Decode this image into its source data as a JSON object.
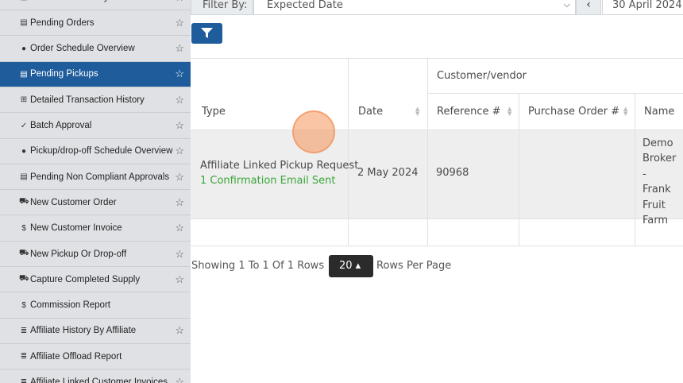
{
  "sidebar": {
    "items": [
      {
        "label": "Transaction History",
        "icon": "clipboard-icon",
        "glyph": "▤",
        "star": true,
        "active": false
      },
      {
        "label": "Pending Orders",
        "icon": "clipboard-icon",
        "glyph": "▤",
        "star": true,
        "active": false
      },
      {
        "label": "Order Schedule Overview",
        "icon": "clock-icon",
        "glyph": "●",
        "star": true,
        "active": false
      },
      {
        "label": "Pending Pickups",
        "icon": "clipboard-icon",
        "glyph": "▤",
        "star": true,
        "active": true
      },
      {
        "label": "Detailed Transaction History",
        "icon": "table-icon",
        "glyph": "⊞",
        "star": true,
        "active": false
      },
      {
        "label": "Batch Approval",
        "icon": "check-icon",
        "glyph": "✓",
        "star": true,
        "active": false
      },
      {
        "label": "Pickup/drop-off Schedule Overview",
        "icon": "clock-icon",
        "glyph": "●",
        "star": true,
        "active": false
      },
      {
        "label": "Pending Non Compliant Approvals",
        "icon": "clipboard-icon",
        "glyph": "▤",
        "star": true,
        "active": false
      },
      {
        "label": "New Customer Order",
        "icon": "truck-icon",
        "glyph": "⛟",
        "star": true,
        "active": false
      },
      {
        "label": "New Customer Invoice",
        "icon": "dollar-icon",
        "glyph": "$",
        "star": true,
        "active": false
      },
      {
        "label": "New Pickup Or Drop-off",
        "icon": "truck-icon",
        "glyph": "⛟",
        "star": true,
        "active": false
      },
      {
        "label": "Capture Completed Supply",
        "icon": "cart-icon",
        "glyph": "⛟",
        "star": true,
        "active": false
      },
      {
        "label": "Commission Report",
        "icon": "dollar-icon",
        "glyph": "$",
        "star": false,
        "active": false
      },
      {
        "label": "Affiliate History By Affiliate",
        "icon": "bar-chart-icon",
        "glyph": "≣",
        "star": true,
        "active": false
      },
      {
        "label": "Affiliate Offload Report",
        "icon": "bar-chart-icon",
        "glyph": "≣",
        "star": false,
        "active": false
      },
      {
        "label": "Affiliate Linked Customer Invoices",
        "icon": "bar-chart-icon",
        "glyph": "≣",
        "star": true,
        "active": false
      }
    ],
    "star_glyph": "☆"
  },
  "filter": {
    "label": "Filter By:",
    "selected": "Expected Date",
    "prev_glyph": "‹",
    "date_value": "30 April 2024",
    "filter_button_icon": "filter-icon"
  },
  "table": {
    "group_header": "Customer/vendor",
    "headers": {
      "type": "Type",
      "date": "Date",
      "reference": "Reference #",
      "purchase_order": "Purchase Order #",
      "name": "Name"
    },
    "rows": [
      {
        "type": "Affiliate Linked Pickup Request",
        "status": "1 Confirmation Email Sent",
        "date": "2 May 2024",
        "reference": "90968",
        "purchase_order": "",
        "name_lines": [
          "Demo",
          "Broker -",
          "Frank",
          "Fruit",
          "Farm"
        ]
      }
    ]
  },
  "pager": {
    "showing": "Showing 1 To 1 Of 1 Rows",
    "rows_per_page_value": "20 ▴",
    "rows_per_page_label": "Rows Per Page"
  },
  "colors": {
    "accent": "#1e5c9b",
    "status_green": "#3aa53a",
    "sidebar_bg": "#dfe1e5"
  }
}
